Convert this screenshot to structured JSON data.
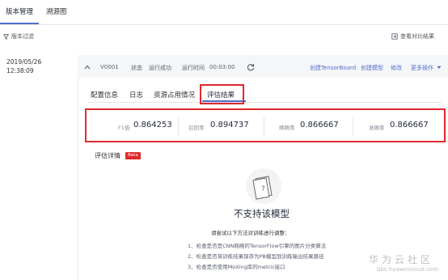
{
  "top_tabs": [
    {
      "label": "版本管理",
      "active": true
    },
    {
      "label": "溯源图",
      "active": false
    }
  ],
  "filter": {
    "label": "版本过滤",
    "icon": "filter-icon"
  },
  "compare": {
    "label": "查看对比结果",
    "icon": "compare-icon"
  },
  "version_list": [
    {
      "date": "2019/05/26",
      "time": "12:38:09"
    }
  ],
  "version_header": {
    "expand_icon": "chevron-up-icon",
    "version": "V0001",
    "status_label": "状态",
    "status_value": "运行成功",
    "runtime_label": "运行时间",
    "runtime_value": "00:03:00",
    "refresh_icon": "refresh-icon",
    "actions": [
      "创建TensorBoard",
      "创建模型",
      "修改",
      "更多操作"
    ],
    "more_icon": "chevron-down-icon"
  },
  "detail_tabs": [
    {
      "label": "配置信息",
      "active": false
    },
    {
      "label": "日志",
      "active": false
    },
    {
      "label": "资源占用情况",
      "active": false
    },
    {
      "label": "评估结果",
      "active": true
    }
  ],
  "metrics": [
    {
      "label": "F1值",
      "value": "0.864253"
    },
    {
      "label": "召回率",
      "value": "0.894737"
    },
    {
      "label": "精确率",
      "value": "0.866667"
    },
    {
      "label": "准确率",
      "value": "0.866667"
    }
  ],
  "eval_details": {
    "title": "评估详情",
    "badge": "Beta"
  },
  "unsupported": {
    "icon": "unsupported-model-icon",
    "title": "不支持该模型",
    "suggest": "请尝试以下方法对训练进行调整：",
    "tips": [
      "1、检查是否是CNN网络的TensorFlow引擎的图片分类算法",
      "2、检查是否将训练结果保存为PB模型到训练输出结果路径",
      "3、检查是否使用MoXing库的metric接口"
    ]
  },
  "watermark": {
    "brand": "华为云社区",
    "url": "bbs.huaweicloud.com"
  },
  "colors": {
    "accent": "#526ecc",
    "highlight_box": "#e0282c",
    "header_bg": "#f5f6f8"
  }
}
